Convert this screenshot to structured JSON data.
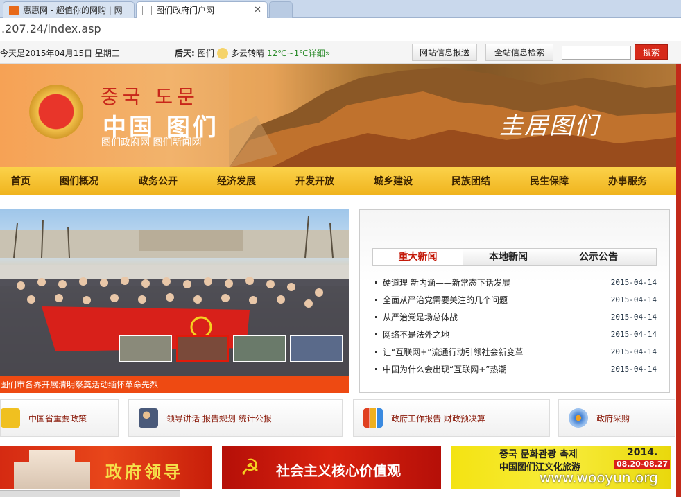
{
  "browser": {
    "tabs": [
      {
        "label": "惠惠网 - 超值你的网购 | 网"
      },
      {
        "label": "图们政府门户网"
      }
    ],
    "address": ".207.24/index.asp"
  },
  "topbar": {
    "date": "今天是2015年04月15日  星期三",
    "weather_label": "后天:",
    "weather_city": "图们",
    "weather_cond": "多云转晴",
    "weather_temp": "12℃~1℃详细»",
    "btn_report": "网站信息报送",
    "btn_search_all": "全站信息检索",
    "search_button": "搜索"
  },
  "banner": {
    "korean": "중국  도문",
    "chinese": "中国  图们",
    "subtitle": "图们政府网  图们新闻网",
    "calligraphy": "圭居图们"
  },
  "nav": [
    "首页",
    "图们概况",
    "政务公开",
    "经济发展",
    "开发开放",
    "城乡建设",
    "民族团结",
    "民生保障",
    "办事服务"
  ],
  "slideshow": {
    "caption": "图们市各界开展清明祭奠活动缅怀革命先烈"
  },
  "news": {
    "tabs": [
      "重大新闻",
      "本地新闻",
      "公示公告"
    ],
    "items": [
      {
        "title": "硬道理  新内涵——新常态下话发展",
        "date": "2015-04-14"
      },
      {
        "title": "全面从严治党需要关注的几个问题",
        "date": "2015-04-14"
      },
      {
        "title": "从严治党是场总体战",
        "date": "2015-04-14"
      },
      {
        "title": "网络不是法外之地",
        "date": "2015-04-14"
      },
      {
        "title": "让“互联网+”流通行动引领社会新变革",
        "date": "2015-04-14"
      },
      {
        "title": "中国为什么会出现“互联网+”热潮",
        "date": "2015-04-14"
      }
    ]
  },
  "quicklinks": [
    {
      "label": "中国省重要政策"
    },
    {
      "label": "领导讲话  报告规划  统计公报"
    },
    {
      "label": "政府工作报告  财政预决算"
    },
    {
      "label": "政府采购"
    }
  ],
  "banners": {
    "b1": "政府领导",
    "b2": "社会主义核心价值观",
    "b3_line1": "중국 문화관광 축제",
    "b3_line2": "中国图们江文化旅游",
    "b3_year": "2014.",
    "b3_dates": "08.20-08.27"
  },
  "watermark": "www.wooyun.org"
}
